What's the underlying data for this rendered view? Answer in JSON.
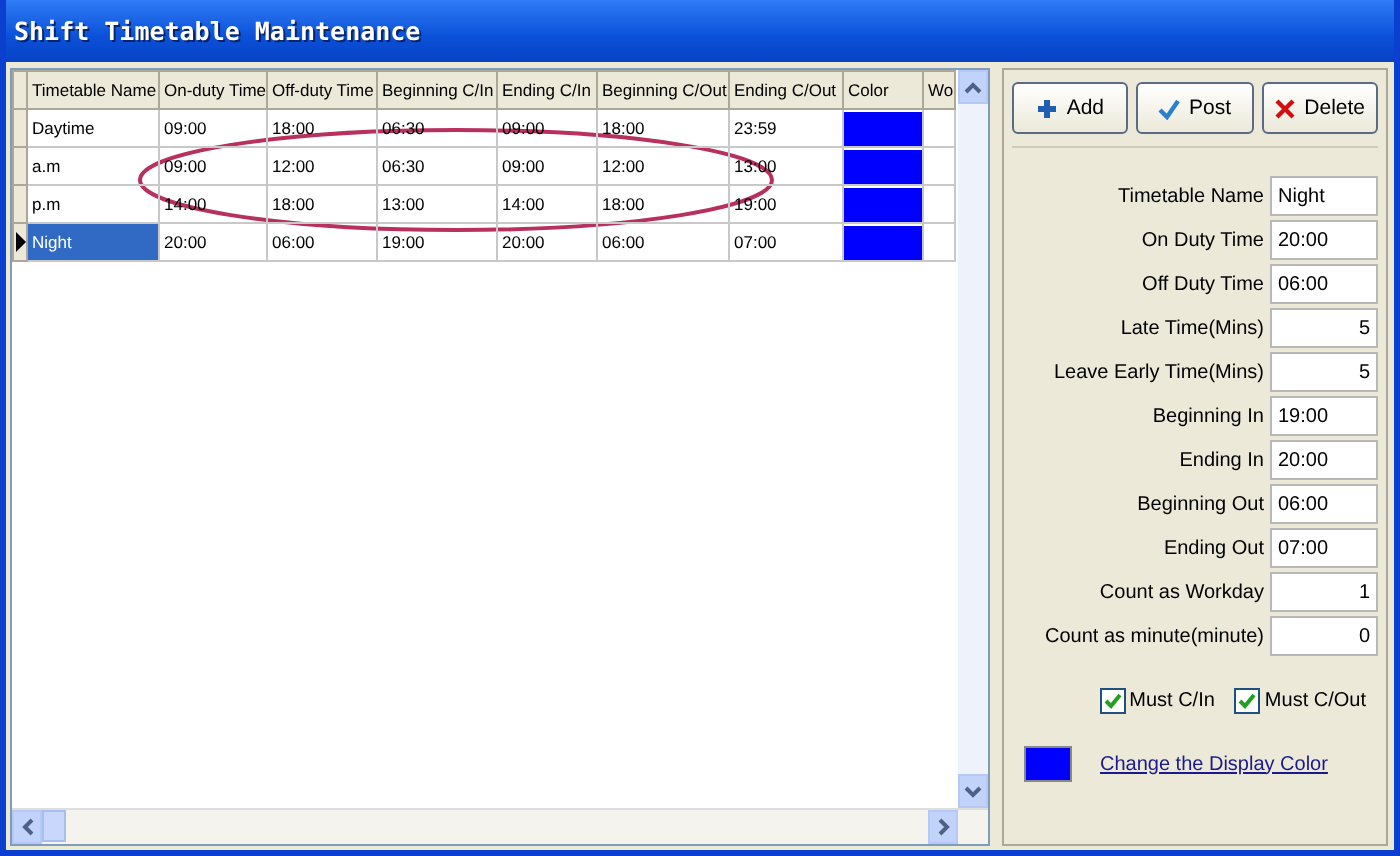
{
  "window": {
    "title": "Shift Timetable Maintenance"
  },
  "grid": {
    "columns": [
      "Timetable Name",
      "On-duty Time",
      "Off-duty Time",
      "Beginning C/In",
      "Ending C/In",
      "Beginning C/Out",
      "Ending C/Out",
      "Color",
      "Wo"
    ],
    "rows": [
      {
        "cells": [
          "Daytime",
          "09:00",
          "18:00",
          "06:30",
          "09:00",
          "18:00",
          "23:59"
        ],
        "color": "#0000ff",
        "selected": false
      },
      {
        "cells": [
          "a.m",
          "09:00",
          "12:00",
          "06:30",
          "09:00",
          "12:00",
          "13:00"
        ],
        "color": "#0000ff",
        "selected": false
      },
      {
        "cells": [
          "p.m",
          "14:00",
          "18:00",
          "13:00",
          "14:00",
          "18:00",
          "19:00"
        ],
        "color": "#0000ff",
        "selected": false
      },
      {
        "cells": [
          "Night",
          "20:00",
          "06:00",
          "19:00",
          "20:00",
          "06:00",
          "07:00"
        ],
        "color": "#0000ff",
        "selected": true
      }
    ]
  },
  "panel": {
    "buttons": [
      {
        "kind": "add",
        "label": "Add"
      },
      {
        "kind": "post",
        "label": "Post"
      },
      {
        "kind": "delete",
        "label": "Delete"
      }
    ],
    "fields": [
      {
        "label": "Timetable Name",
        "value": "Night",
        "kind": "text"
      },
      {
        "label": "On Duty Time",
        "value": "20:00",
        "kind": "text"
      },
      {
        "label": "Off Duty Time",
        "value": "06:00",
        "kind": "text"
      },
      {
        "label": "Late Time(Mins)",
        "value": "5",
        "kind": "number"
      },
      {
        "label": "Leave Early Time(Mins)",
        "value": "5",
        "kind": "number"
      },
      {
        "label": "Beginning In",
        "value": "19:00",
        "kind": "text"
      },
      {
        "label": "Ending In",
        "value": "20:00",
        "kind": "text"
      },
      {
        "label": "Beginning Out",
        "value": "06:00",
        "kind": "text"
      },
      {
        "label": "Ending Out",
        "value": "07:00",
        "kind": "text"
      },
      {
        "label": "Count as Workday",
        "value": "1",
        "kind": "number"
      },
      {
        "label": "Count as minute(minute)",
        "value": "0",
        "kind": "number"
      }
    ],
    "checkboxes": [
      {
        "label": "Must C/In",
        "checked": true
      },
      {
        "label": "Must C/Out",
        "checked": true
      }
    ],
    "display_color": {
      "color": "#0000ff",
      "link": "Change the Display Color"
    }
  }
}
